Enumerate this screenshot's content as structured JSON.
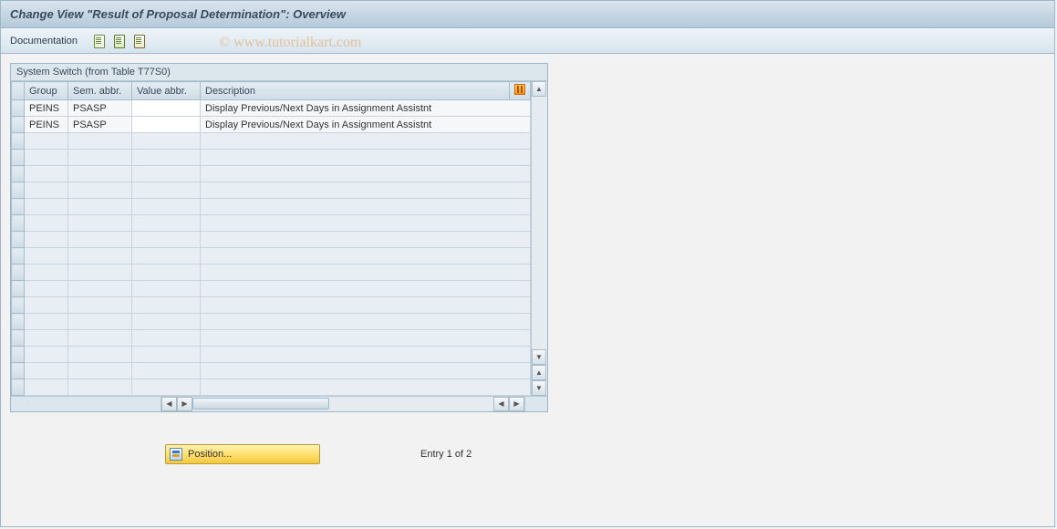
{
  "title": "Change View \"Result of Proposal Determination\": Overview",
  "toolbar": {
    "documentation": "Documentation"
  },
  "watermark": "© www.tutorialkart.com",
  "table": {
    "caption": "System Switch (from Table T77S0)",
    "columns": {
      "group": "Group",
      "sem": "Sem. abbr.",
      "val": "Value abbr.",
      "desc": "Description"
    },
    "rows": [
      {
        "group": "PEINS",
        "sem": "PSASP",
        "val": "",
        "desc": "Display Previous/Next Days in Assignment Assistnt"
      },
      {
        "group": "PEINS",
        "sem": "PSASP",
        "val": "",
        "desc": "Display Previous/Next Days in Assignment Assistnt"
      }
    ],
    "empty_rows": 16
  },
  "footer": {
    "position_label": "Position...",
    "entry_text": "Entry 1 of 2"
  }
}
